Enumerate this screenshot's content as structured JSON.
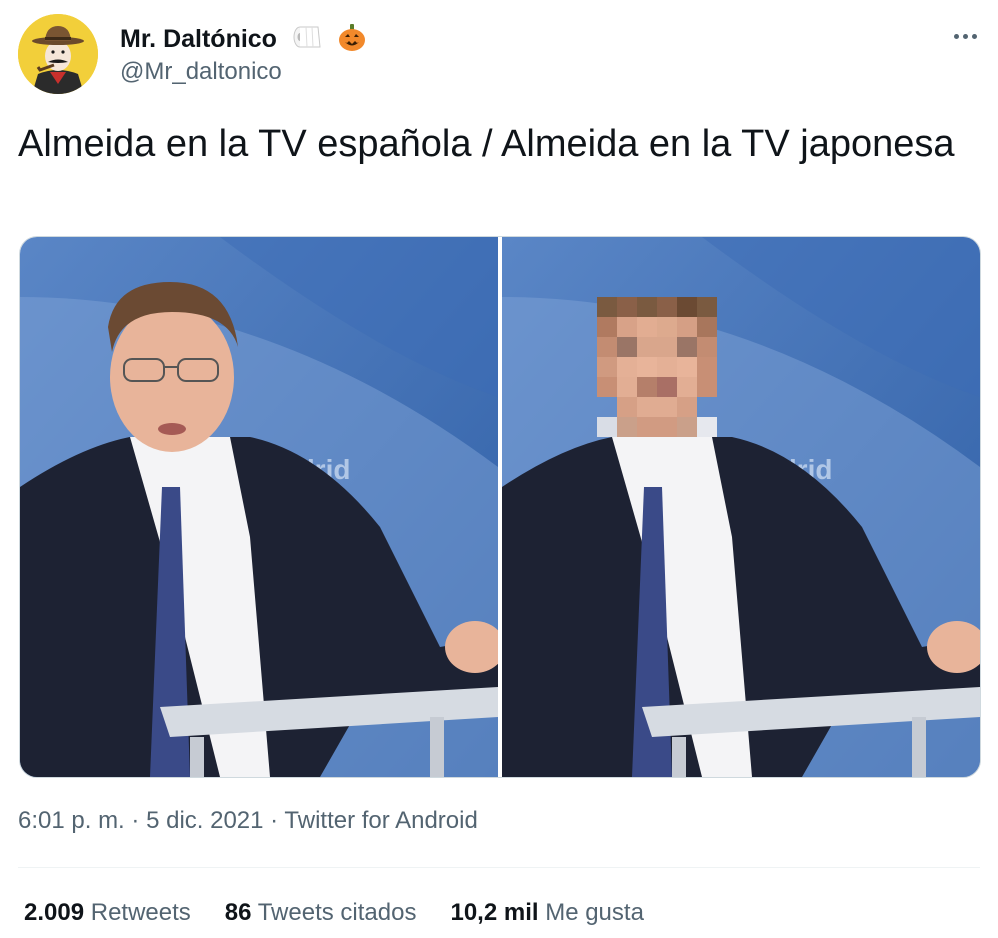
{
  "author": {
    "display_name": "Mr. Daltónico",
    "handle": "@Mr_daltonico",
    "name_emojis": [
      "toilet-paper-icon",
      "jack-o-lantern-icon"
    ]
  },
  "tweet": {
    "text": "Almeida en la TV española / Almeida en la TV japonesa",
    "time": "6:01 p. m.",
    "separator": "·",
    "date": "5 dic. 2021",
    "source": "Twitter for Android"
  },
  "media": {
    "photos": [
      {
        "desc": "left-photo"
      },
      {
        "desc": "right-photo-pixelated"
      }
    ],
    "backdrop_text": "adrid"
  },
  "stats": {
    "retweets_count": "2.009",
    "retweets_label": "Retweets",
    "quotes_count": "86",
    "quotes_label": "Tweets citados",
    "likes_count": "10,2 mil",
    "likes_label": "Me gusta"
  },
  "colors": {
    "text_primary": "#0f1419",
    "text_secondary": "#536471",
    "border": "#cfd9de",
    "avatar_bg": "#f2cf3a",
    "studio_blue": "#5a86c6"
  }
}
